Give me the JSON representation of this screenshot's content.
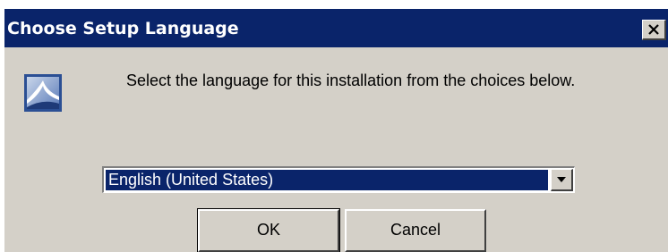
{
  "window": {
    "title": "Choose Setup Language",
    "close_label": "X"
  },
  "dialog": {
    "icon": "setup-installer-icon",
    "prompt": "Select the language for this installation from the choices below."
  },
  "language_select": {
    "selected": "English (United States)",
    "arrow_icon": "chevron-down-icon"
  },
  "buttons": {
    "ok_label": "OK",
    "cancel_label": "Cancel"
  },
  "colors": {
    "titlebar": "#0a246a",
    "face": "#d4d0c8",
    "selection": "#0a246a"
  }
}
